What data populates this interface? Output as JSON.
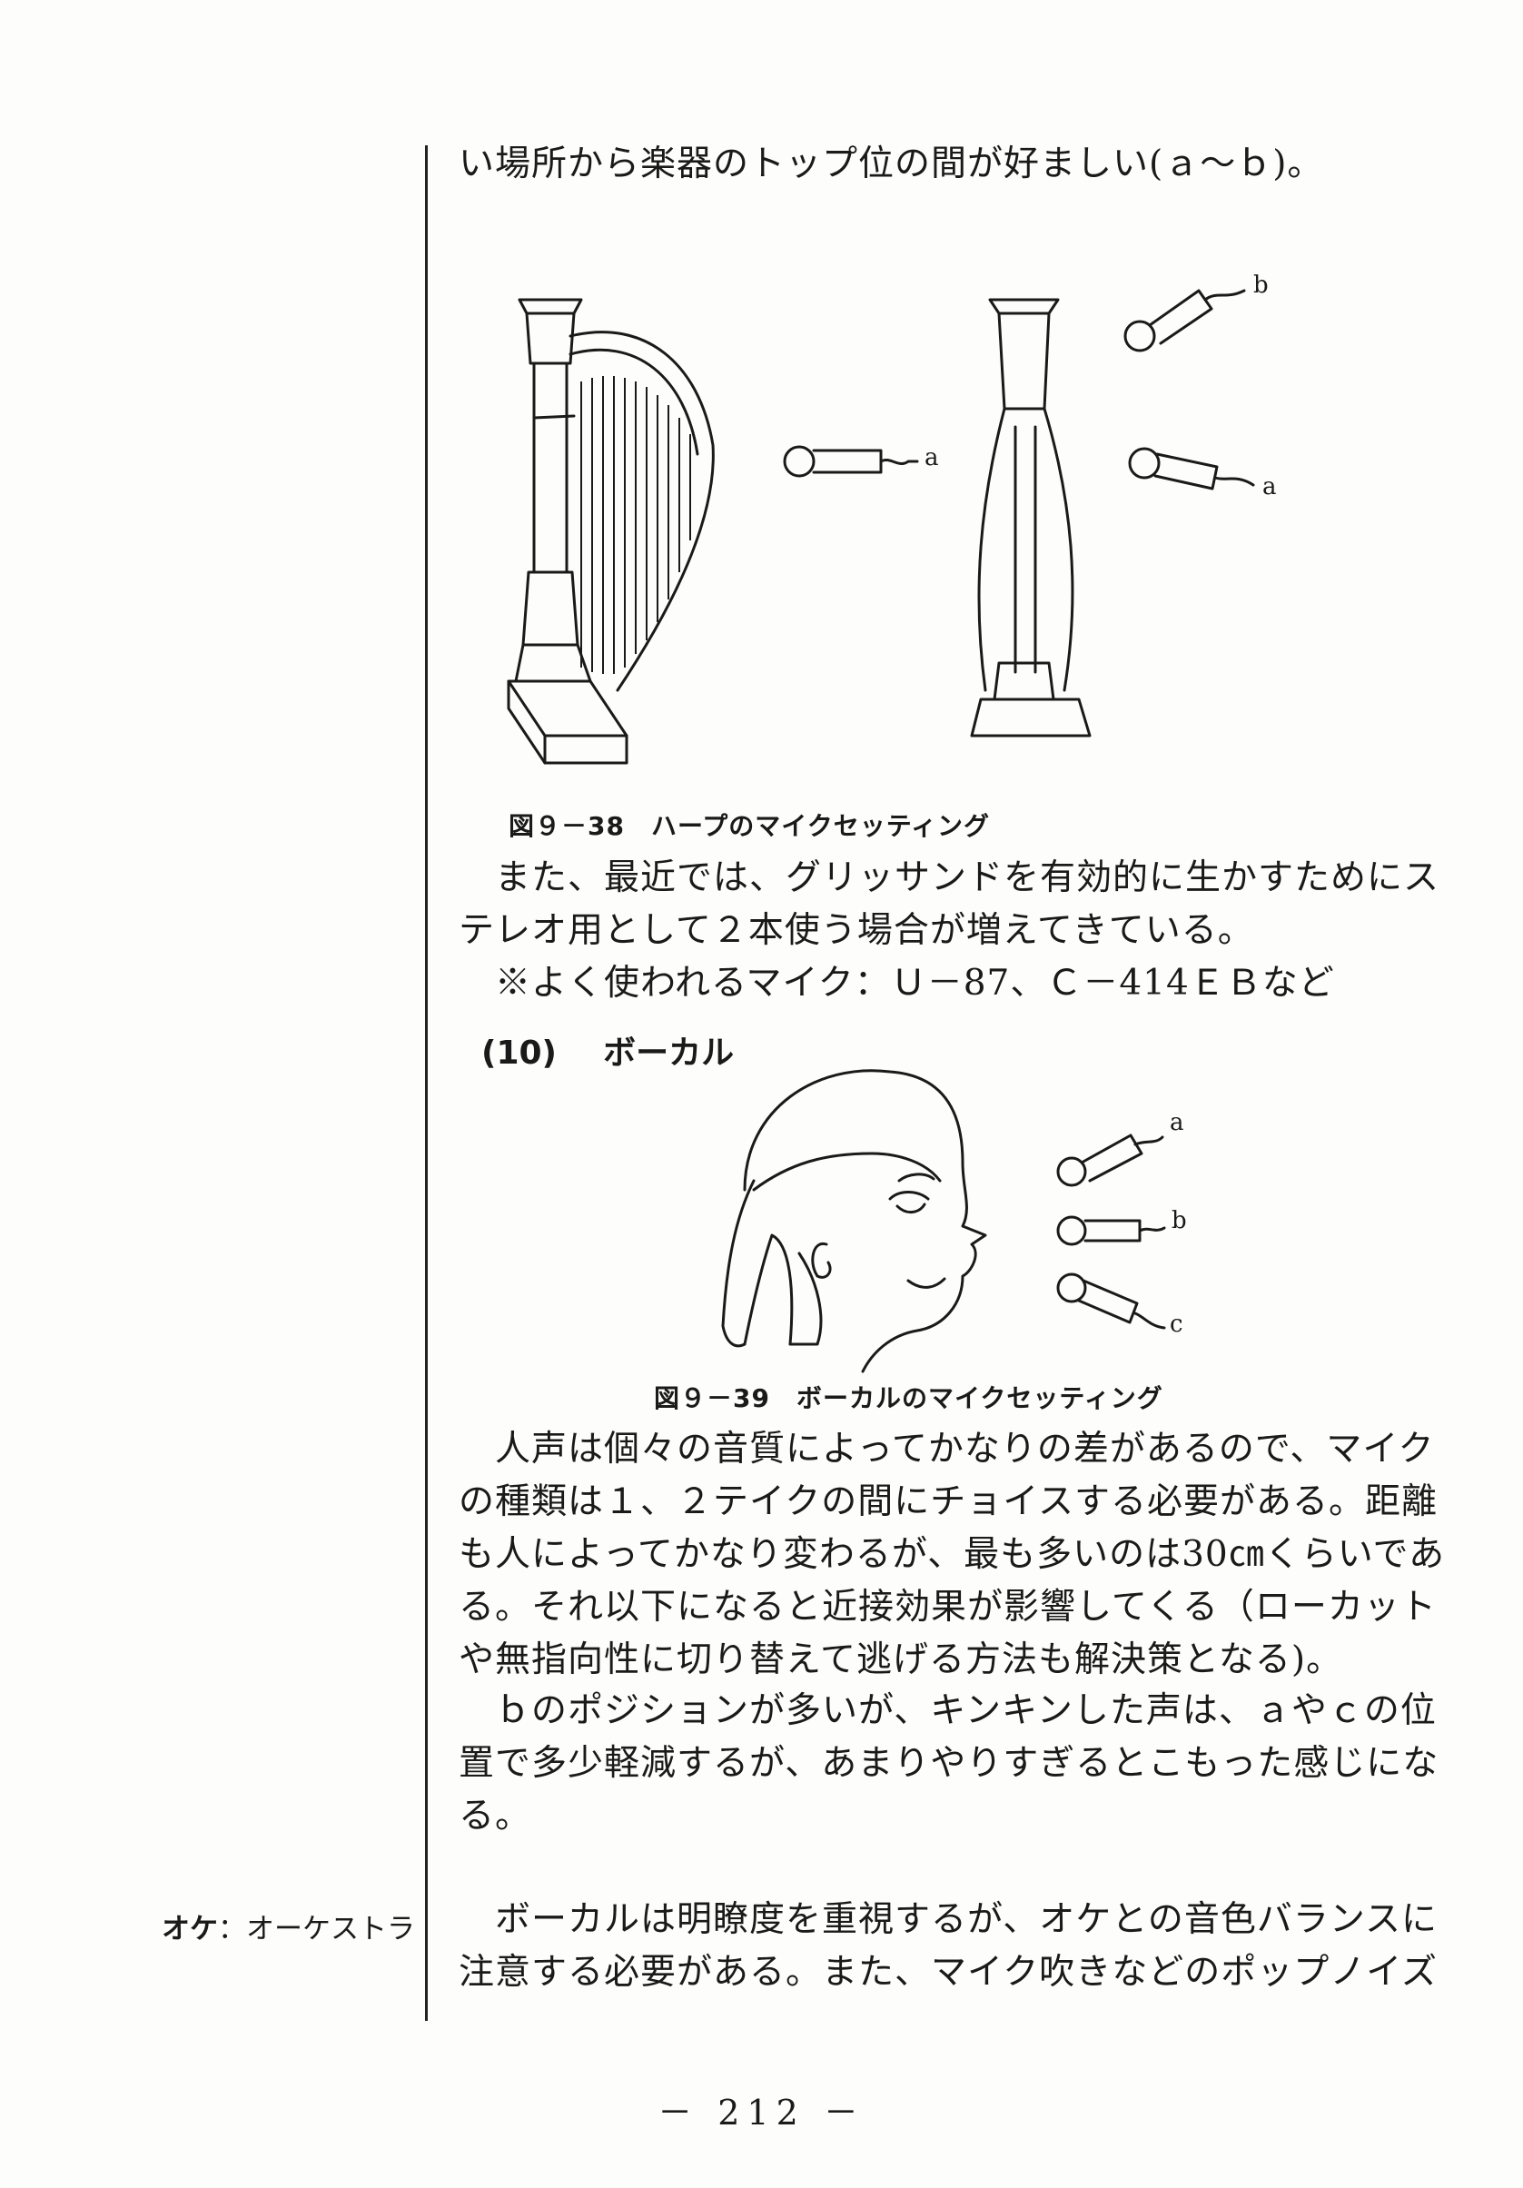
{
  "paragraph_top": "い場所から楽器のトップ位の間が好ましい(ａ～ｂ)。",
  "figure_38": {
    "caption": "図９－38　ハープのマイクセッティング",
    "labels": {
      "left_a": "a",
      "right_b": "b",
      "right_a": "a"
    }
  },
  "paragraph_harp": [
    "　また、最近では、グリッサンドを有効的に生かすためにス",
    "テレオ用として２本使う場合が増えてきている。",
    "　※よく使われるマイク：Ｕ－87、Ｃ－414ＥＢなど"
  ],
  "section": {
    "number": "(10)",
    "title": "ボーカル"
  },
  "figure_39": {
    "caption": "図９－39　ボーカルのマイクセッティング",
    "labels": {
      "a": "a",
      "b": "b",
      "c": "c"
    }
  },
  "paragraph_vocal_1": [
    "　人声は個々の音質によってかなりの差があるので、マイク",
    "の種類は１、２テイクの間にチョイスする必要がある。距離",
    "も人によってかなり変わるが、最も多いのは30㎝くらいであ",
    "る。それ以下になると近接効果が影響してくる（ローカット",
    "や無指向性に切り替えて逃げる方法も解決策となる)。"
  ],
  "paragraph_vocal_2": [
    "　ｂのポジションが多いが、キンキンした声は、ａやｃの位",
    "置で多少軽減するが、あまりやりすぎるとこもった感じにな",
    "る。"
  ],
  "paragraph_vocal_3": [
    "　ボーカルは明瞭度を重視するが、オケとの音色バランスに",
    "注意する必要がある。また、マイク吹きなどのポップノイズ"
  ],
  "margin_note": {
    "term": "オケ",
    "separator": "：",
    "definition": "オーケストラ"
  },
  "page_number": "－ 212 －"
}
